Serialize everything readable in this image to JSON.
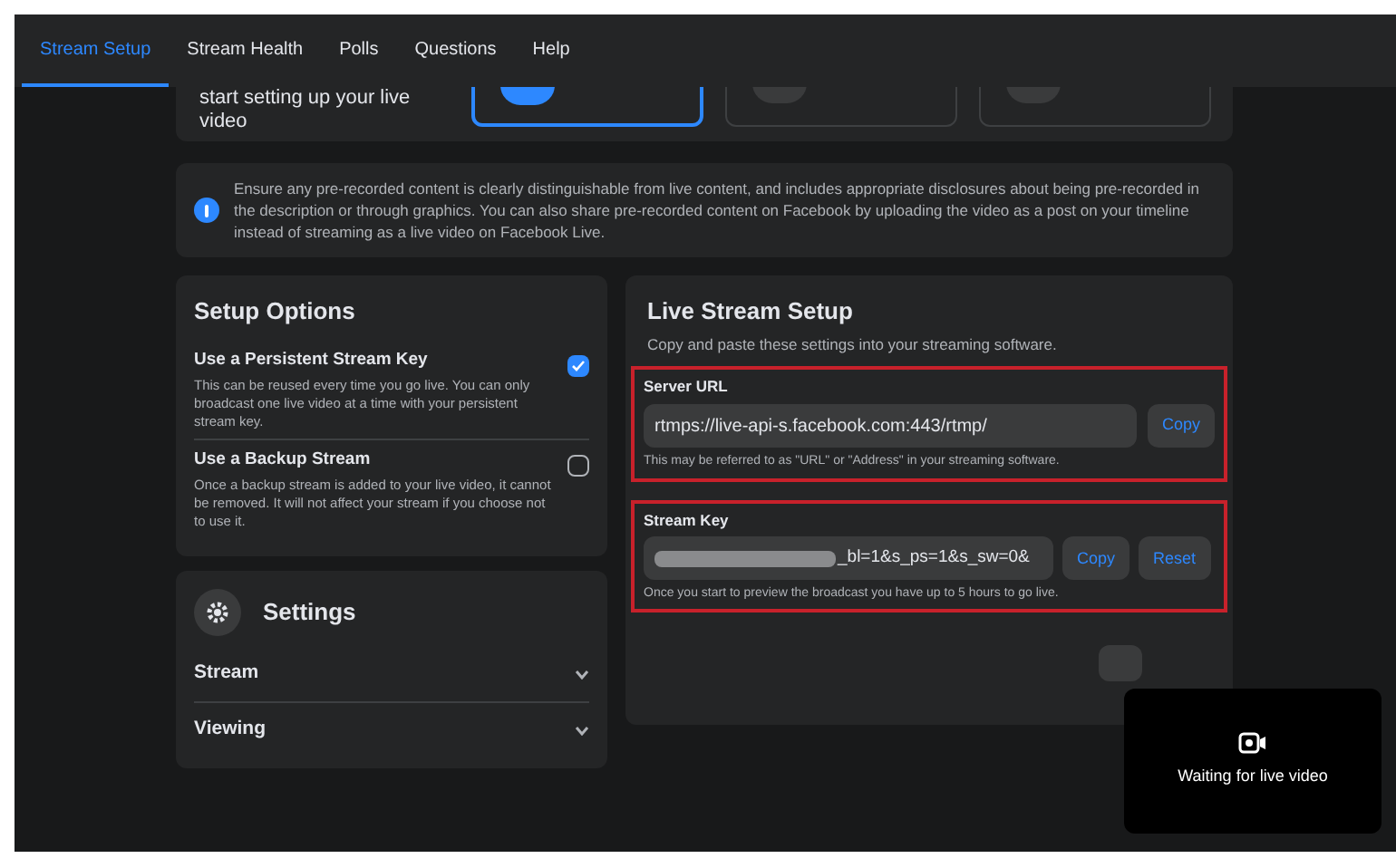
{
  "tabs": [
    {
      "label": "Stream Setup",
      "selected": true
    },
    {
      "label": "Stream Health",
      "selected": false
    },
    {
      "label": "Polls",
      "selected": false
    },
    {
      "label": "Questions",
      "selected": false
    },
    {
      "label": "Help",
      "selected": false
    }
  ],
  "video_source": {
    "prompt": "start setting up your live video",
    "options": [
      {
        "selected": true
      },
      {
        "selected": false
      },
      {
        "selected": false
      }
    ]
  },
  "notice": "Ensure any pre-recorded content is clearly distinguishable from live content, and includes appropriate disclosures about being pre-recorded in the description or through graphics. You can also share pre-recorded content on Facebook by uploading the video as a post on your timeline instead of streaming as a live video on Facebook Live.",
  "setup_options": {
    "title": "Setup Options",
    "options": [
      {
        "label": "Use a Persistent Stream Key",
        "description": "This can be reused every time you go live. You can only broadcast one live video at a time with your persistent stream key.",
        "checked": true
      },
      {
        "label": "Use a Backup Stream",
        "description": "Once a backup stream is added to your live video, it cannot be removed. It will not affect your stream if you choose not to use it.",
        "checked": false
      }
    ]
  },
  "settings": {
    "title": "Settings",
    "sections": [
      {
        "label": "Stream",
        "expanded": false
      },
      {
        "label": "Viewing",
        "expanded": false
      }
    ]
  },
  "live_stream_setup": {
    "title": "Live Stream Setup",
    "subtitle": "Copy and paste these settings into your streaming software.",
    "server_url": {
      "label": "Server URL",
      "value": "rtmps://live-api-s.facebook.com:443/rtmp/",
      "button": "Copy",
      "hint": "This may be referred to as \"URL\" or \"Address\" in your streaming software."
    },
    "stream_key": {
      "label": "Stream Key",
      "value": "_bl=1&s_ps=1&s_sw=0&",
      "buttons": [
        "Copy",
        "Reset"
      ],
      "hint": "Once you start to preview the broadcast you have up to 5 hours to go live."
    }
  },
  "preview": {
    "status": "Waiting for live video"
  }
}
